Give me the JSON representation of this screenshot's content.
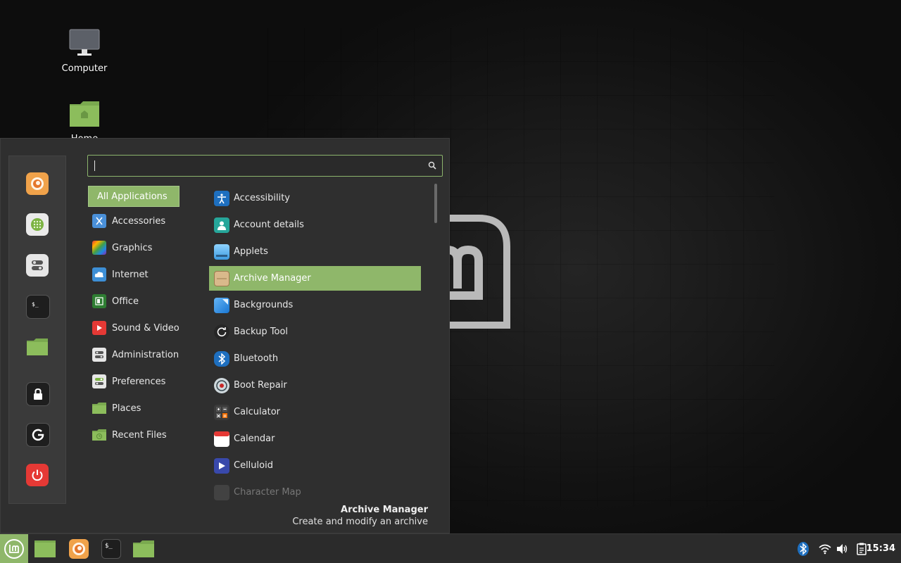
{
  "desktop": {
    "icons": [
      {
        "label": "Computer",
        "icon": "computer-icon"
      },
      {
        "label": "Home",
        "icon": "home-folder-icon"
      }
    ]
  },
  "menu": {
    "search": {
      "value": "",
      "placeholder": ""
    },
    "favorites": [
      {
        "name": "firefox",
        "icon": "firefox-icon"
      },
      {
        "name": "software-manager",
        "icon": "software-manager-icon"
      },
      {
        "name": "system-settings",
        "icon": "settings-toggle-icon"
      },
      {
        "name": "terminal",
        "icon": "terminal-icon"
      },
      {
        "name": "files",
        "icon": "folder-icon"
      },
      {
        "name": "lock-screen",
        "icon": "lock-icon"
      },
      {
        "name": "logout",
        "icon": "logout-icon"
      },
      {
        "name": "quit",
        "icon": "power-icon"
      }
    ],
    "categories": [
      {
        "label": "All Applications",
        "active": true
      },
      {
        "label": "Accessories",
        "icon": "accessories-icon"
      },
      {
        "label": "Graphics",
        "icon": "graphics-icon"
      },
      {
        "label": "Internet",
        "icon": "internet-cloud-icon"
      },
      {
        "label": "Office",
        "icon": "office-icon"
      },
      {
        "label": "Sound & Video",
        "icon": "sound-video-icon"
      },
      {
        "label": "Administration",
        "icon": "administration-icon"
      },
      {
        "label": "Preferences",
        "icon": "preferences-icon"
      },
      {
        "label": "Places",
        "icon": "places-folder-icon"
      },
      {
        "label": "Recent Files",
        "icon": "recent-files-icon"
      }
    ],
    "applications": [
      {
        "label": "Accessibility",
        "icon": "accessibility-icon"
      },
      {
        "label": "Account details",
        "icon": "account-icon"
      },
      {
        "label": "Applets",
        "icon": "applets-icon"
      },
      {
        "label": "Archive Manager",
        "icon": "archive-icon",
        "active": true
      },
      {
        "label": "Backgrounds",
        "icon": "backgrounds-icon"
      },
      {
        "label": "Backup Tool",
        "icon": "backup-icon"
      },
      {
        "label": "Bluetooth",
        "icon": "bluetooth-icon"
      },
      {
        "label": "Boot Repair",
        "icon": "boot-repair-icon"
      },
      {
        "label": "Calculator",
        "icon": "calculator-icon"
      },
      {
        "label": "Calendar",
        "icon": "calendar-icon"
      },
      {
        "label": "Celluloid",
        "icon": "celluloid-icon"
      },
      {
        "label": "Character Map",
        "icon": "character-map-icon",
        "faded": true
      }
    ],
    "description": {
      "title": "Archive Manager",
      "text": "Create and modify an archive"
    }
  },
  "panel": {
    "launchers": [
      {
        "name": "show-desktop",
        "icon": "show-desktop-icon"
      },
      {
        "name": "firefox",
        "icon": "firefox-icon"
      },
      {
        "name": "terminal",
        "icon": "terminal-icon"
      },
      {
        "name": "files",
        "icon": "folder-icon"
      }
    ],
    "tray": [
      "bluetooth-icon",
      "wifi-icon",
      "volume-icon",
      "clipboard-icon"
    ],
    "clock": "15:34"
  },
  "colors": {
    "accent": "#8fb76a",
    "menu_bg": "#2f2f2f",
    "panel_bg": "#2b2b2b"
  }
}
